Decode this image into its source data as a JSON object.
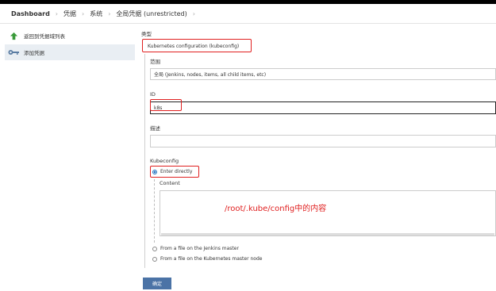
{
  "breadcrumb": {
    "items": [
      "Dashboard",
      "凭据",
      "系统",
      "全局凭据 (unrestricted)"
    ],
    "separator": "›"
  },
  "sidebar": {
    "items": [
      {
        "label": "返回到凭据域列表",
        "icon": "arrow-up-icon"
      },
      {
        "label": "添加凭据",
        "icon": "key-icon",
        "active": true
      }
    ]
  },
  "form": {
    "kind_label": "类型",
    "kind_value": "Kubernetes configuration (kubeconfig)",
    "scope_label": "范围",
    "scope_value": "全局 (Jenkins, nodes, items, all child items, etc)",
    "id_label": "ID",
    "id_value": "k8s",
    "description_label": "描述",
    "description_value": "",
    "kubeconfig_label": "Kubeconfig",
    "options": [
      {
        "label": "Enter directly",
        "checked": true
      },
      {
        "label": "From a file on the Jenkins master",
        "checked": false
      },
      {
        "label": "From a file on the Kubernetes master node",
        "checked": false
      }
    ],
    "content_label": "Content",
    "content_value": "",
    "submit_label": "确定"
  },
  "annotation": "/root/.kube/config中的内容",
  "colors": {
    "annotation_red": "#e02020",
    "button_blue": "#4b73a6",
    "active_bg": "#e9eef3"
  }
}
